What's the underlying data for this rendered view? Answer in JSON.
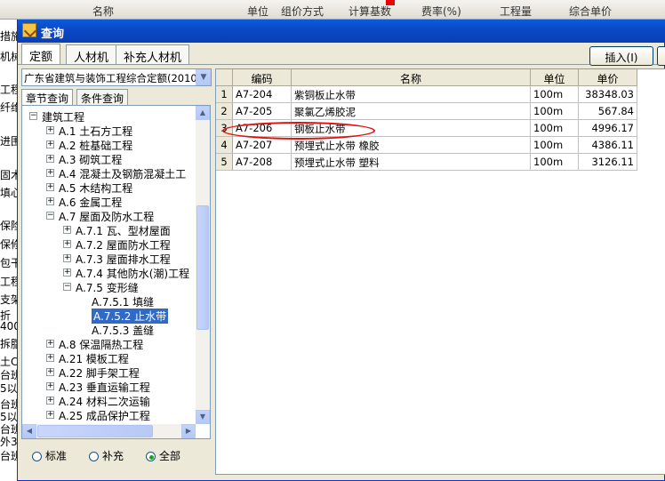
{
  "background_app": {
    "header": [
      "名称",
      "单位",
      "组价方式",
      "计算基数",
      "费率(%)",
      "工程量",
      "综合单价"
    ],
    "rows": [
      "措施",
      "机械",
      "工程",
      "纤维",
      "进围",
      "固木",
      "填心",
      "保险",
      "保修",
      "包干",
      "工程",
      "支架",
      "折",
      "400",
      "拆脂",
      "土C2",
      "台班",
      "5以",
      "台班",
      "5以",
      "台班",
      "外3",
      "台班"
    ]
  },
  "dialog": {
    "title": "查询",
    "tabs": [
      "定额",
      "人材机",
      "补充人材机"
    ],
    "insert_button": "插入(I)",
    "quota_library": "广东省建筑与装饰工程综合定额(2010)",
    "sub_tabs": [
      "章节查询",
      "条件查询"
    ],
    "tree": [
      {
        "label": "建筑工程",
        "toggle": "−"
      },
      {
        "label": "A.1 土石方工程",
        "toggle": "+"
      },
      {
        "label": "A.2 桩基础工程",
        "toggle": "+"
      },
      {
        "label": "A.3 砌筑工程",
        "toggle": "+"
      },
      {
        "label": "A.4 混凝土及钢筋混凝土工",
        "toggle": "+"
      },
      {
        "label": "A.5 木结构工程",
        "toggle": "+"
      },
      {
        "label": "A.6 金属工程",
        "toggle": "+"
      },
      {
        "label": "A.7 屋面及防水工程",
        "toggle": "−"
      },
      {
        "label": "A.7.1 瓦、型材屋面",
        "toggle": "+"
      },
      {
        "label": "A.7.2 屋面防水工程",
        "toggle": "+"
      },
      {
        "label": "A.7.3 屋面排水工程",
        "toggle": "+"
      },
      {
        "label": "A.7.4 其他防水(潮)工程",
        "toggle": "+"
      },
      {
        "label": "A.7.5 变形缝",
        "toggle": "−"
      },
      {
        "label": "A.7.5.1 填缝",
        "toggle": ""
      },
      {
        "label": "A.7.5.2 止水带",
        "toggle": ""
      },
      {
        "label": "A.7.5.3 盖缝",
        "toggle": ""
      },
      {
        "label": "A.8 保温隔热工程",
        "toggle": "+"
      },
      {
        "label": "A.21 模板工程",
        "toggle": "+"
      },
      {
        "label": "A.22 脚手架工程",
        "toggle": "+"
      },
      {
        "label": "A.23 垂直运输工程",
        "toggle": "+"
      },
      {
        "label": "A.24 材料二次运输",
        "toggle": "+"
      },
      {
        "label": "A.25 成品保护工程",
        "toggle": "+"
      }
    ],
    "radio_options": [
      "标准",
      "补充",
      "全部"
    ],
    "radio_selected": "全部",
    "grid": {
      "columns": [
        "编码",
        "名称",
        "单位",
        "单价"
      ],
      "rows": [
        {
          "no": "1",
          "code": "A7-204",
          "name": "紫铜板止水带",
          "unit": "100m",
          "price": "38348.03"
        },
        {
          "no": "2",
          "code": "A7-205",
          "name": "聚氯乙烯胶泥",
          "unit": "100m",
          "price": "567.84"
        },
        {
          "no": "3",
          "code": "A7-206",
          "name": "钢板止水带",
          "unit": "100m",
          "price": "4996.17"
        },
        {
          "no": "4",
          "code": "A7-207",
          "name": "预埋式止水带 橡胶",
          "unit": "100m",
          "price": "4386.11"
        },
        {
          "no": "5",
          "code": "A7-208",
          "name": "预埋式止水带 塑料",
          "unit": "100m",
          "price": "3126.11"
        }
      ]
    }
  }
}
